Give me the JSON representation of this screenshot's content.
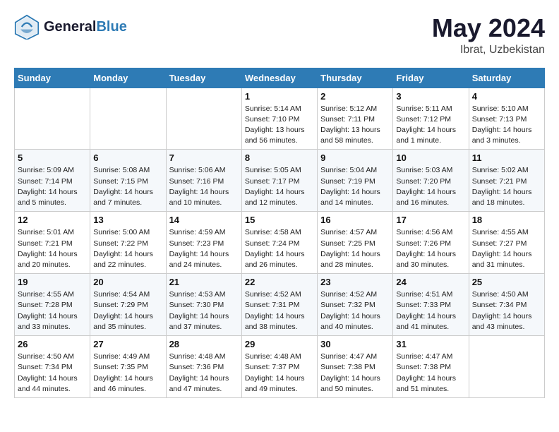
{
  "header": {
    "logo_line1": "General",
    "logo_line2": "Blue",
    "month_year": "May 2024",
    "location": "Ibrat, Uzbekistan"
  },
  "weekdays": [
    "Sunday",
    "Monday",
    "Tuesday",
    "Wednesday",
    "Thursday",
    "Friday",
    "Saturday"
  ],
  "weeks": [
    [
      {
        "day": "",
        "sunrise": "",
        "sunset": "",
        "daylight": ""
      },
      {
        "day": "",
        "sunrise": "",
        "sunset": "",
        "daylight": ""
      },
      {
        "day": "",
        "sunrise": "",
        "sunset": "",
        "daylight": ""
      },
      {
        "day": "1",
        "sunrise": "Sunrise: 5:14 AM",
        "sunset": "Sunset: 7:10 PM",
        "daylight": "Daylight: 13 hours and 56 minutes."
      },
      {
        "day": "2",
        "sunrise": "Sunrise: 5:12 AM",
        "sunset": "Sunset: 7:11 PM",
        "daylight": "Daylight: 13 hours and 58 minutes."
      },
      {
        "day": "3",
        "sunrise": "Sunrise: 5:11 AM",
        "sunset": "Sunset: 7:12 PM",
        "daylight": "Daylight: 14 hours and 1 minute."
      },
      {
        "day": "4",
        "sunrise": "Sunrise: 5:10 AM",
        "sunset": "Sunset: 7:13 PM",
        "daylight": "Daylight: 14 hours and 3 minutes."
      }
    ],
    [
      {
        "day": "5",
        "sunrise": "Sunrise: 5:09 AM",
        "sunset": "Sunset: 7:14 PM",
        "daylight": "Daylight: 14 hours and 5 minutes."
      },
      {
        "day": "6",
        "sunrise": "Sunrise: 5:08 AM",
        "sunset": "Sunset: 7:15 PM",
        "daylight": "Daylight: 14 hours and 7 minutes."
      },
      {
        "day": "7",
        "sunrise": "Sunrise: 5:06 AM",
        "sunset": "Sunset: 7:16 PM",
        "daylight": "Daylight: 14 hours and 10 minutes."
      },
      {
        "day": "8",
        "sunrise": "Sunrise: 5:05 AM",
        "sunset": "Sunset: 7:17 PM",
        "daylight": "Daylight: 14 hours and 12 minutes."
      },
      {
        "day": "9",
        "sunrise": "Sunrise: 5:04 AM",
        "sunset": "Sunset: 7:19 PM",
        "daylight": "Daylight: 14 hours and 14 minutes."
      },
      {
        "day": "10",
        "sunrise": "Sunrise: 5:03 AM",
        "sunset": "Sunset: 7:20 PM",
        "daylight": "Daylight: 14 hours and 16 minutes."
      },
      {
        "day": "11",
        "sunrise": "Sunrise: 5:02 AM",
        "sunset": "Sunset: 7:21 PM",
        "daylight": "Daylight: 14 hours and 18 minutes."
      }
    ],
    [
      {
        "day": "12",
        "sunrise": "Sunrise: 5:01 AM",
        "sunset": "Sunset: 7:21 PM",
        "daylight": "Daylight: 14 hours and 20 minutes."
      },
      {
        "day": "13",
        "sunrise": "Sunrise: 5:00 AM",
        "sunset": "Sunset: 7:22 PM",
        "daylight": "Daylight: 14 hours and 22 minutes."
      },
      {
        "day": "14",
        "sunrise": "Sunrise: 4:59 AM",
        "sunset": "Sunset: 7:23 PM",
        "daylight": "Daylight: 14 hours and 24 minutes."
      },
      {
        "day": "15",
        "sunrise": "Sunrise: 4:58 AM",
        "sunset": "Sunset: 7:24 PM",
        "daylight": "Daylight: 14 hours and 26 minutes."
      },
      {
        "day": "16",
        "sunrise": "Sunrise: 4:57 AM",
        "sunset": "Sunset: 7:25 PM",
        "daylight": "Daylight: 14 hours and 28 minutes."
      },
      {
        "day": "17",
        "sunrise": "Sunrise: 4:56 AM",
        "sunset": "Sunset: 7:26 PM",
        "daylight": "Daylight: 14 hours and 30 minutes."
      },
      {
        "day": "18",
        "sunrise": "Sunrise: 4:55 AM",
        "sunset": "Sunset: 7:27 PM",
        "daylight": "Daylight: 14 hours and 31 minutes."
      }
    ],
    [
      {
        "day": "19",
        "sunrise": "Sunrise: 4:55 AM",
        "sunset": "Sunset: 7:28 PM",
        "daylight": "Daylight: 14 hours and 33 minutes."
      },
      {
        "day": "20",
        "sunrise": "Sunrise: 4:54 AM",
        "sunset": "Sunset: 7:29 PM",
        "daylight": "Daylight: 14 hours and 35 minutes."
      },
      {
        "day": "21",
        "sunrise": "Sunrise: 4:53 AM",
        "sunset": "Sunset: 7:30 PM",
        "daylight": "Daylight: 14 hours and 37 minutes."
      },
      {
        "day": "22",
        "sunrise": "Sunrise: 4:52 AM",
        "sunset": "Sunset: 7:31 PM",
        "daylight": "Daylight: 14 hours and 38 minutes."
      },
      {
        "day": "23",
        "sunrise": "Sunrise: 4:52 AM",
        "sunset": "Sunset: 7:32 PM",
        "daylight": "Daylight: 14 hours and 40 minutes."
      },
      {
        "day": "24",
        "sunrise": "Sunrise: 4:51 AM",
        "sunset": "Sunset: 7:33 PM",
        "daylight": "Daylight: 14 hours and 41 minutes."
      },
      {
        "day": "25",
        "sunrise": "Sunrise: 4:50 AM",
        "sunset": "Sunset: 7:34 PM",
        "daylight": "Daylight: 14 hours and 43 minutes."
      }
    ],
    [
      {
        "day": "26",
        "sunrise": "Sunrise: 4:50 AM",
        "sunset": "Sunset: 7:34 PM",
        "daylight": "Daylight: 14 hours and 44 minutes."
      },
      {
        "day": "27",
        "sunrise": "Sunrise: 4:49 AM",
        "sunset": "Sunset: 7:35 PM",
        "daylight": "Daylight: 14 hours and 46 minutes."
      },
      {
        "day": "28",
        "sunrise": "Sunrise: 4:48 AM",
        "sunset": "Sunset: 7:36 PM",
        "daylight": "Daylight: 14 hours and 47 minutes."
      },
      {
        "day": "29",
        "sunrise": "Sunrise: 4:48 AM",
        "sunset": "Sunset: 7:37 PM",
        "daylight": "Daylight: 14 hours and 49 minutes."
      },
      {
        "day": "30",
        "sunrise": "Sunrise: 4:47 AM",
        "sunset": "Sunset: 7:38 PM",
        "daylight": "Daylight: 14 hours and 50 minutes."
      },
      {
        "day": "31",
        "sunrise": "Sunrise: 4:47 AM",
        "sunset": "Sunset: 7:38 PM",
        "daylight": "Daylight: 14 hours and 51 minutes."
      },
      {
        "day": "",
        "sunrise": "",
        "sunset": "",
        "daylight": ""
      }
    ]
  ]
}
